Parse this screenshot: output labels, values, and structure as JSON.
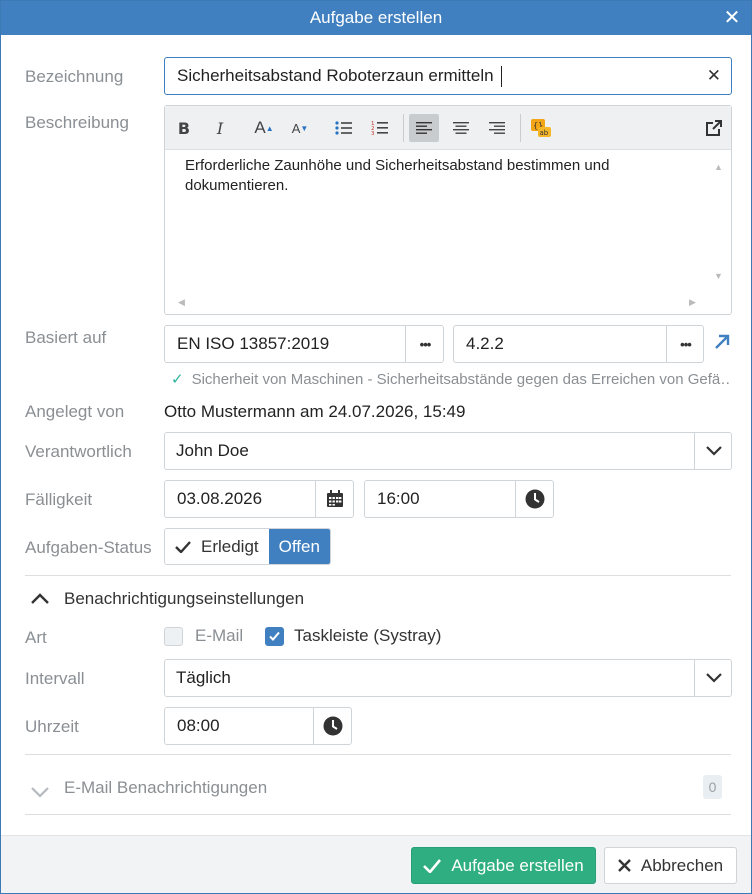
{
  "dialog": {
    "title": "Aufgabe erstellen"
  },
  "fields": {
    "bezeichnung": {
      "label": "Bezeichnung",
      "value": "Sicherheitsabstand Roboterzaun ermitteln"
    },
    "beschreibung": {
      "label": "Beschreibung",
      "text": "Erforderliche Zaunhöhe und Sicherheitsabstand bestimmen und dokumentieren."
    },
    "basiert_auf": {
      "label": "Basiert auf",
      "norm": "EN ISO 13857:2019",
      "section": "4.2.2",
      "more": "•••",
      "hint": "Sicherheit von Maschinen - Sicherheitsabstände gegen das Erreichen von Gefä…"
    },
    "angelegt_von": {
      "label": "Angelegt von",
      "value": "Otto Mustermann am 24.07.2026, 15:49"
    },
    "verantwortlich": {
      "label": "Verantwortlich",
      "value": "John Doe"
    },
    "faelligkeit": {
      "label": "Fälligkeit",
      "date": "03.08.2026",
      "time": "16:00"
    },
    "status": {
      "label": "Aufgaben-Status",
      "options": [
        "Erledigt",
        "Offen"
      ],
      "selected": "Offen"
    }
  },
  "notifications": {
    "title": "Benachrichtigungseinstellungen",
    "art_label": "Art",
    "email_label": "E-Mail",
    "email_checked": false,
    "taskbar_label": "Taskleiste (Systray)",
    "taskbar_checked": true,
    "interval_label": "Intervall",
    "interval_value": "Täglich",
    "time_label": "Uhrzeit",
    "time_value": "08:00"
  },
  "email_notifications": {
    "title": "E-Mail Benachrichtigungen",
    "count": "0"
  },
  "buttons": {
    "create": "Aufgabe erstellen",
    "cancel": "Abbrechen"
  },
  "colors": {
    "accent": "#4180c0",
    "success": "#2fae82",
    "hint_check": "#2bb39a"
  }
}
